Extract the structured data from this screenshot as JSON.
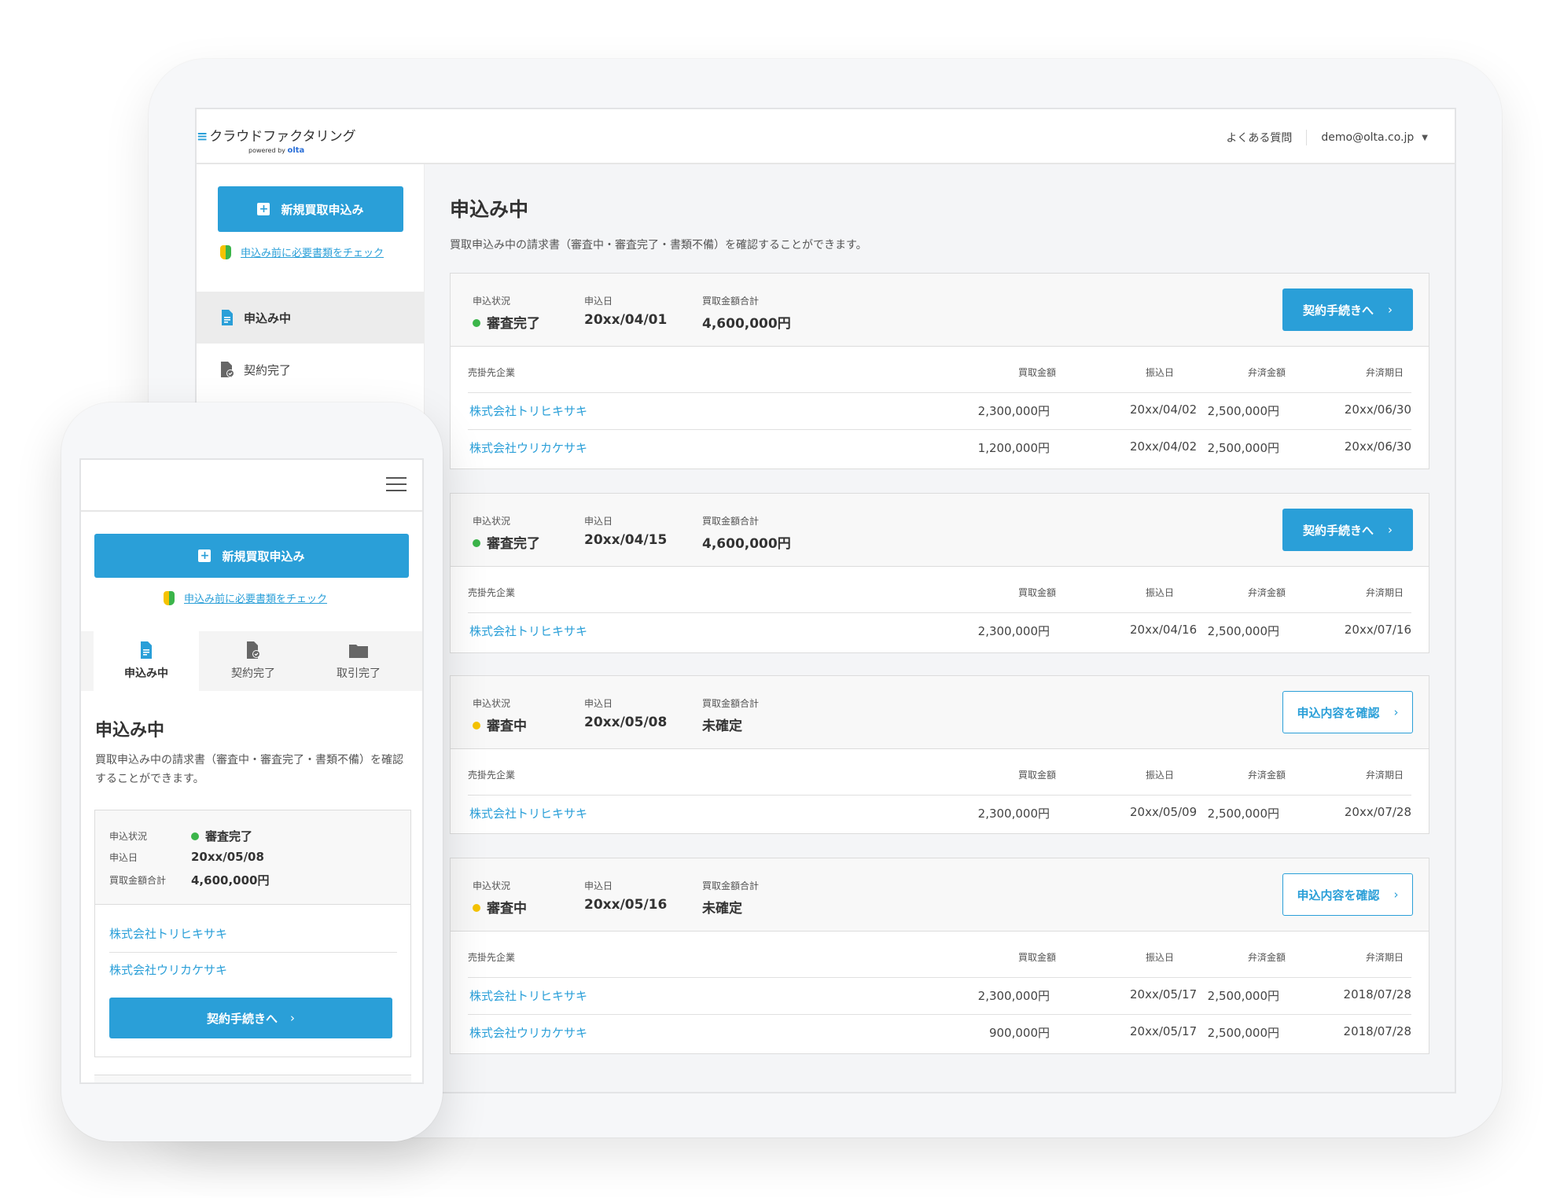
{
  "colors": {
    "accent": "#2a9fd8",
    "status_done": "#3bb54a",
    "status_review": "#f5c300"
  },
  "header": {
    "logo_title": "クラウドファクタリング",
    "logo_powered": "powered by",
    "logo_brand": "olta",
    "faq": "よくある質問",
    "account": "demo@olta.co.jp"
  },
  "sidebar": {
    "new_button": "新規買取申込み",
    "check_link": "申込み前に必要書類をチェック",
    "items": [
      {
        "label": "申込み中",
        "icon": "document-icon",
        "active": true
      },
      {
        "label": "契約完了",
        "icon": "document-check-icon",
        "active": false
      }
    ]
  },
  "main": {
    "title": "申込み中",
    "description": "買取申込み中の請求書（審査中・審査完了・書類不備）を確認することができます。",
    "labels": {
      "status": "申込状況",
      "date": "申込日",
      "total": "買取金額合計",
      "company": "売掛先企業",
      "amount": "買取金額",
      "transfer": "振込日",
      "repay_amount": "弁済金額",
      "repay_date": "弁済期日"
    },
    "cards": [
      {
        "status": "審査完了",
        "status_color": "#3bb54a",
        "date": "20xx/04/01",
        "total": "4,600,000円",
        "button": "契約手続きへ",
        "button_style": "filled",
        "rows": [
          {
            "company": "株式会社トリヒキサキ",
            "amount": "2,300,000円",
            "transfer": "20xx/04/02",
            "repay_amount": "2,500,000円",
            "repay_date": "20xx/06/30"
          },
          {
            "company": "株式会社ウリカケサキ",
            "amount": "1,200,000円",
            "transfer": "20xx/04/02",
            "repay_amount": "2,500,000円",
            "repay_date": "20xx/06/30"
          }
        ]
      },
      {
        "status": "審査完了",
        "status_color": "#3bb54a",
        "date": "20xx/04/15",
        "total": "4,600,000円",
        "button": "契約手続きへ",
        "button_style": "filled",
        "rows": [
          {
            "company": "株式会社トリヒキサキ",
            "amount": "2,300,000円",
            "transfer": "20xx/04/16",
            "repay_amount": "2,500,000円",
            "repay_date": "20xx/07/16"
          }
        ]
      },
      {
        "status": "審査中",
        "status_color": "#f5c300",
        "date": "20xx/05/08",
        "total": "未確定",
        "button": "申込内容を確認",
        "button_style": "outline",
        "rows": [
          {
            "company": "株式会社トリヒキサキ",
            "amount": "2,300,000円",
            "transfer": "20xx/05/09",
            "repay_amount": "2,500,000円",
            "repay_date": "20xx/07/28"
          }
        ]
      },
      {
        "status": "審査中",
        "status_color": "#f5c300",
        "date": "20xx/05/16",
        "total": "未確定",
        "button": "申込内容を確認",
        "button_style": "outline",
        "rows": [
          {
            "company": "株式会社トリヒキサキ",
            "amount": "2,300,000円",
            "transfer": "20xx/05/17",
            "repay_amount": "2,500,000円",
            "repay_date": "2018/07/28"
          },
          {
            "company": "株式会社ウリカケサキ",
            "amount": "900,000円",
            "transfer": "20xx/05/17",
            "repay_amount": "2,500,000円",
            "repay_date": "2018/07/28"
          }
        ]
      }
    ]
  },
  "mobile": {
    "new_button": "新規買取申込み",
    "check_link": "申込み前に必要書類をチェック",
    "tabs": [
      {
        "label": "申込み中",
        "icon": "document-icon",
        "active": true
      },
      {
        "label": "契約完了",
        "icon": "document-check-icon",
        "active": false
      },
      {
        "label": "取引完了",
        "icon": "folder-icon",
        "active": false
      }
    ],
    "title": "申込み中",
    "description": "買取申込み中の請求書（審査中・審査完了・書類不備）を確認することができます。",
    "card": {
      "status_label": "申込状況",
      "status": "審査完了",
      "date_label": "申込日",
      "date": "20xx/05/08",
      "total_label": "買取金額合計",
      "total": "4,600,000円",
      "companies": [
        "株式会社トリヒキサキ",
        "株式会社ウリカケサキ"
      ],
      "button": "契約手続きへ"
    }
  }
}
